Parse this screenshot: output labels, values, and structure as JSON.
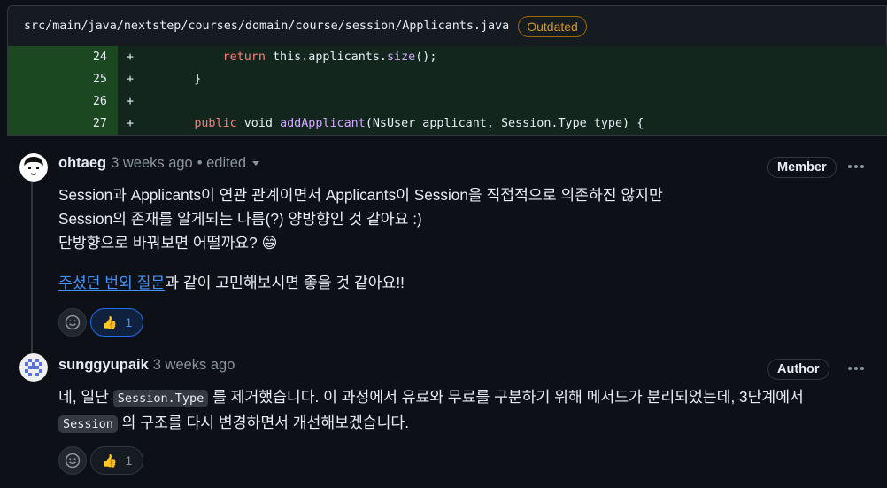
{
  "file": {
    "path": "src/main/java/nextstep/courses/domain/course/session/Applicants.java",
    "badge": "Outdated"
  },
  "diff": [
    {
      "num": "24",
      "sign": "+",
      "tokens": [
        {
          "t": "        ",
          "c": "txt"
        },
        {
          "t": "return",
          "c": "kw"
        },
        {
          "t": " this.applicants.",
          "c": "txt"
        },
        {
          "t": "size",
          "c": "fn"
        },
        {
          "t": "();",
          "c": "txt"
        }
      ]
    },
    {
      "num": "25",
      "sign": "+",
      "tokens": [
        {
          "t": "    }",
          "c": "txt"
        }
      ]
    },
    {
      "num": "26",
      "sign": "+",
      "tokens": []
    },
    {
      "num": "27",
      "sign": "+",
      "tokens": [
        {
          "t": "    ",
          "c": "txt"
        },
        {
          "t": "public",
          "c": "kw"
        },
        {
          "t": " void ",
          "c": "txt"
        },
        {
          "t": "addApplicant",
          "c": "fn"
        },
        {
          "t": "(NsUser applicant, Session.Type type) {",
          "c": "txt"
        }
      ]
    }
  ],
  "comments": [
    {
      "author": "ohtaeg",
      "time": "3 weeks ago",
      "edited": "• edited",
      "role": "Member",
      "lines": [
        "Session과 Applicants이 연관 관계이면서 Applicants이 Session을 직접적으로 의존하진 않지만",
        "Session의 존재를 알게되는 나름(?) 양방향인 것 같아요 :)",
        "단방향으로 바꿔보면 어떨까요? 😄"
      ],
      "link_text": "주셨던 번외 질문",
      "after_link": "과 같이 고민해보시면 좋을 것 같아요!!",
      "reaction": {
        "icon": "👍",
        "count": "1"
      }
    },
    {
      "author": "sunggyupaik",
      "time": "3 weeks ago",
      "role": "Author",
      "line1_pre": "네, 일단 ",
      "line1_code": "Session.Type",
      "line1_post": " 를 제거했습니다. 이 과정에서 유료와 무료를 구분하기 위해 메서드가 분리되었는데, 3단계에서",
      "line2_code": "Session",
      "line2_post": " 의 구조를 다시 변경하면서 개선해보겠습니다.",
      "reaction": {
        "icon": "👍",
        "count": "1"
      }
    }
  ],
  "colors": {
    "accent": "#4493f8",
    "outdated": "#d29922",
    "addition_bg": "#12261e",
    "addition_num_bg": "#1b4721",
    "keyword": "#ff7b72",
    "function": "#d2a8ff"
  },
  "icons": [
    "smiley-icon",
    "thumbs-up-icon",
    "kebab-icon",
    "caret-down-icon"
  ]
}
